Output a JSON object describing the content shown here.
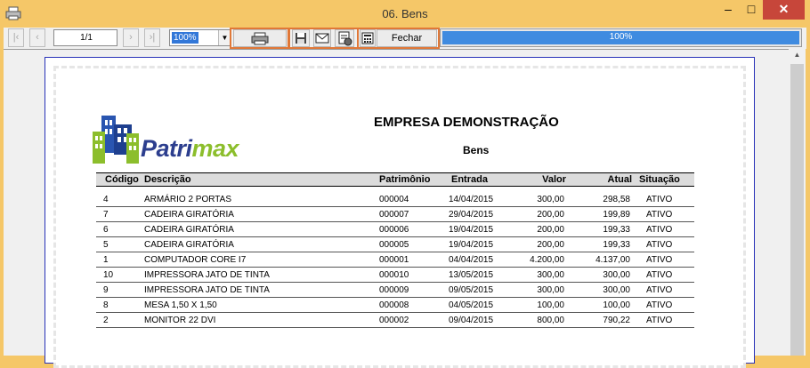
{
  "window": {
    "title": "06. Bens"
  },
  "toolbar": {
    "page": "1/1",
    "zoom": "100%",
    "close_label": "Fechar",
    "progress_text": "100%",
    "progress_value": 100
  },
  "report": {
    "logo_text": "Patrimax",
    "company": "EMPRESA DEMONSTRAÇÃO",
    "subtitle": "Bens",
    "columns": [
      "Código",
      "Descrição",
      "Patrimônio",
      "Entrada",
      "Valor",
      "Atual",
      "Situação"
    ],
    "rows": [
      {
        "codigo": "4",
        "descricao": "ARMÁRIO 2 PORTAS",
        "patrimonio": "000004",
        "entrada": "14/04/2015",
        "valor": "300,00",
        "atual": "298,58",
        "situacao": "ATIVO"
      },
      {
        "codigo": "7",
        "descricao": "CADEIRA GIRATÓRIA",
        "patrimonio": "000007",
        "entrada": "29/04/2015",
        "valor": "200,00",
        "atual": "199,89",
        "situacao": "ATIVO"
      },
      {
        "codigo": "6",
        "descricao": "CADEIRA GIRATÓRIA",
        "patrimonio": "000006",
        "entrada": "19/04/2015",
        "valor": "200,00",
        "atual": "199,33",
        "situacao": "ATIVO"
      },
      {
        "codigo": "5",
        "descricao": "CADEIRA GIRATÓRIA",
        "patrimonio": "000005",
        "entrada": "19/04/2015",
        "valor": "200,00",
        "atual": "199,33",
        "situacao": "ATIVO"
      },
      {
        "codigo": "1",
        "descricao": "COMPUTADOR CORE I7",
        "patrimonio": "000001",
        "entrada": "04/04/2015",
        "valor": "4.200,00",
        "atual": "4.137,00",
        "situacao": "ATIVO"
      },
      {
        "codigo": "10",
        "descricao": "IMPRESSORA JATO DE TINTA",
        "patrimonio": "000010",
        "entrada": "13/05/2015",
        "valor": "300,00",
        "atual": "300,00",
        "situacao": "ATIVO"
      },
      {
        "codigo": "9",
        "descricao": "IMPRESSORA JATO DE TINTA",
        "patrimonio": "000009",
        "entrada": "09/05/2015",
        "valor": "300,00",
        "atual": "300,00",
        "situacao": "ATIVO"
      },
      {
        "codigo": "8",
        "descricao": "MESA 1,50 X 1,50",
        "patrimonio": "000008",
        "entrada": "04/05/2015",
        "valor": "100,00",
        "atual": "100,00",
        "situacao": "ATIVO"
      },
      {
        "codigo": "2",
        "descricao": "MONITOR 22 DVI",
        "patrimonio": "000002",
        "entrada": "09/04/2015",
        "valor": "800,00",
        "atual": "790,22",
        "situacao": "ATIVO"
      }
    ]
  },
  "colors": {
    "titlebar": "#f5c768",
    "close": "#c7463a",
    "highlight": "#e07838",
    "progress": "#3f8be0",
    "frame": "#2731b8"
  }
}
